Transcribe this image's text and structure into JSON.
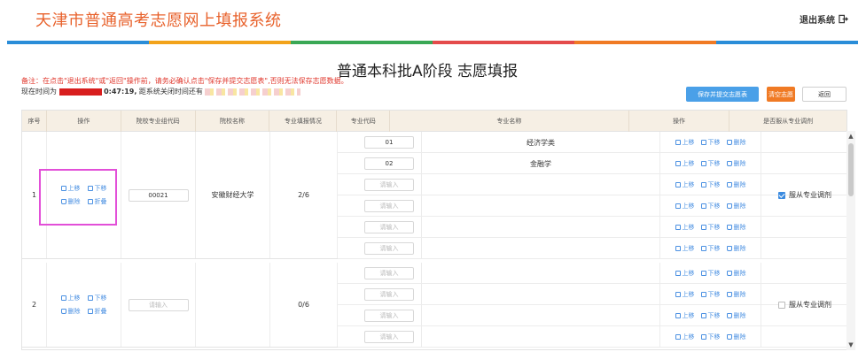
{
  "header": {
    "title": "天津市普通高考志愿网上填报系统",
    "logout_label": "退出系统"
  },
  "colors": {
    "title": "#e8622c",
    "stripe": [
      "#2a8dd8",
      "#f2a31b",
      "#3aa855",
      "#e44b4b",
      "#f07a24",
      "#2a8dd8"
    ],
    "link": "#4a90e2",
    "highlight": "#e24fd8"
  },
  "page": {
    "title": "普通本科批A阶段 志愿填报",
    "notice": "备注：在点击\"退出系统\"或\"返回\"操作前，请务必确认点击\"保存并提交志愿表\",否则无法保存志愿数据。",
    "time_prefix": "现在时间为",
    "time_value": "0:47:19,",
    "close_prefix": "距系统关闭时间还有"
  },
  "buttons": {
    "save": "保存并提交志愿表",
    "clear": "清空志愿",
    "back": "返回"
  },
  "table": {
    "headers": [
      "序号",
      "操作",
      "院校专业组代码",
      "院校名称",
      "专业填报情况",
      "专业代码",
      "专业名称",
      "操作",
      "是否服从专业调剂"
    ],
    "ops": {
      "up": "上移",
      "down": "下移",
      "del": "删除",
      "fold": "折叠"
    },
    "groups": [
      {
        "index": "1",
        "code": "00021",
        "code_placeholder": "",
        "school": "安徽财经大学",
        "status": "2/6",
        "adjust_label": "服从专业调剂",
        "adjust_checked": true,
        "majors": [
          {
            "code": "01",
            "name": "经济学类"
          },
          {
            "code": "02",
            "name": "金融学"
          },
          {
            "code": "",
            "name": ""
          },
          {
            "code": "",
            "name": ""
          },
          {
            "code": "",
            "name": ""
          },
          {
            "code": "",
            "name": ""
          }
        ]
      },
      {
        "index": "2",
        "code": "",
        "code_placeholder": "请输入",
        "school": "",
        "status": "0/6",
        "adjust_label": "服从专业调剂",
        "adjust_checked": false,
        "majors": [
          {
            "code": "",
            "name": ""
          },
          {
            "code": "",
            "name": ""
          },
          {
            "code": "",
            "name": ""
          },
          {
            "code": "",
            "name": ""
          }
        ]
      }
    ],
    "major_code_placeholder": "请输入"
  }
}
